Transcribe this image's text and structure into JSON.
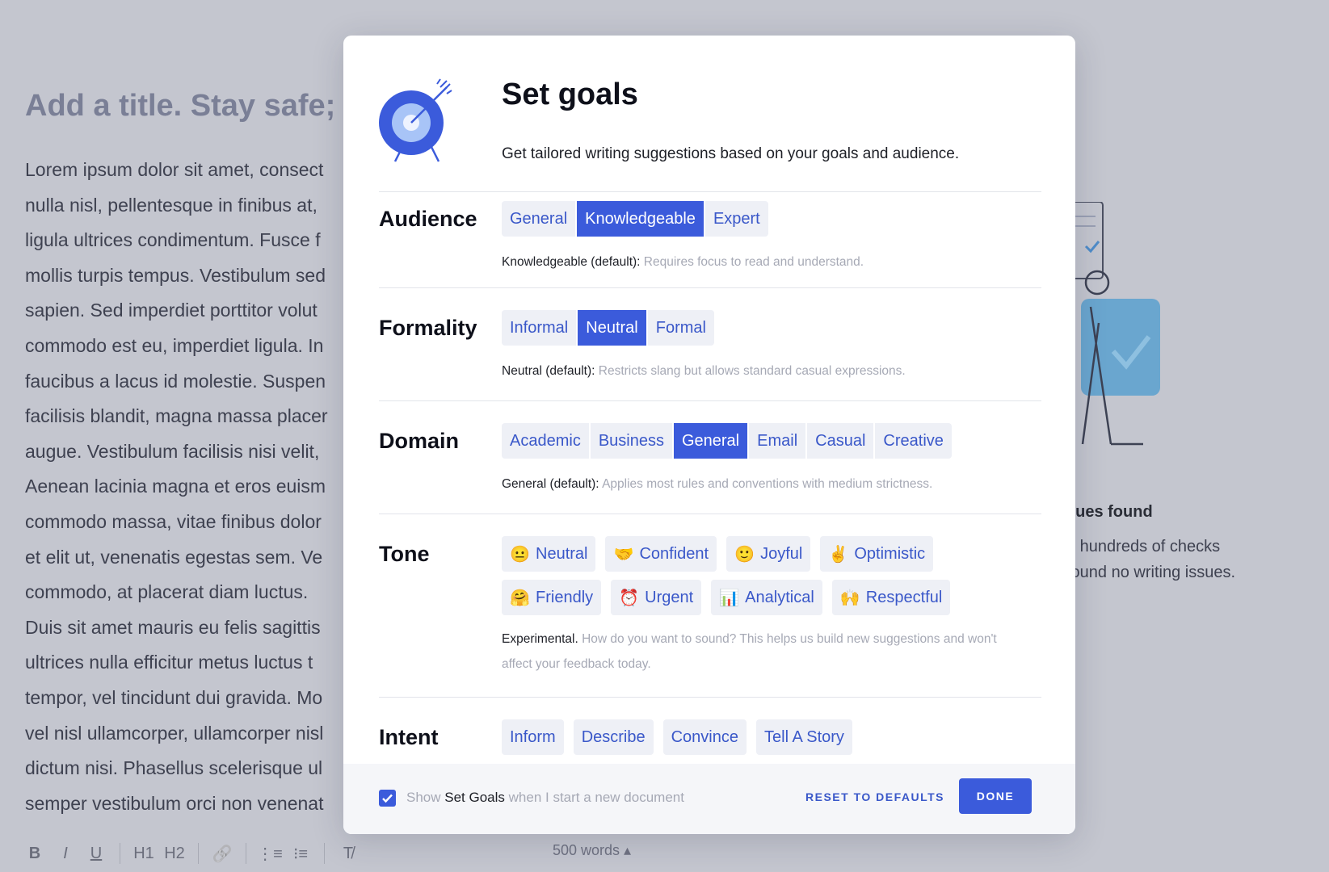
{
  "editor": {
    "title": "Add a title. Stay safe;",
    "body_lines": [
      "Lorem ipsum dolor sit amet, consect",
      "nulla nisl, pellentesque in finibus at,",
      "ligula ultrices condimentum. Fusce f",
      "mollis turpis tempus. Vestibulum sed",
      "sapien. Sed imperdiet porttitor volut",
      "commodo est eu, imperdiet ligula. In",
      "faucibus a lacus id molestie. Suspen",
      "facilisis blandit, magna massa placer",
      "augue. Vestibulum facilisis nisi velit,",
      "Aenean lacinia magna et eros euism",
      "commodo massa, vitae finibus dolor",
      "et elit ut, venenatis egestas sem. Ve",
      "commodo, at placerat diam luctus.",
      "Duis sit amet mauris eu felis sagittis",
      "ultrices nulla efficitur metus luctus t",
      "tempor, vel tincidunt dui gravida. Mo",
      "vel nisl ullamcorper, ullamcorper nisl",
      "dictum nisi. Phasellus scelerisque ul",
      "semper vestibulum orci non venenat"
    ],
    "toolbar": {
      "bold": "B",
      "italic": "I",
      "underline": "U",
      "h1": "H1",
      "h2": "H2",
      "link_icon": "🔗",
      "ordered_list": "⋮≡",
      "bullet_list": "⁝≡",
      "clear_format": "T̸"
    },
    "word_count": "500 words ▴",
    "sidebar": {
      "issues_title": "sues found",
      "issues_line1": "n hundreds of checks",
      "issues_line2": "found no writing issues."
    }
  },
  "modal": {
    "title": "Set goals",
    "subtitle": "Get tailored writing suggestions based on your goals and audience.",
    "audience": {
      "label": "Audience",
      "options": [
        "General",
        "Knowledgeable",
        "Expert"
      ],
      "selected": "Knowledgeable",
      "desc_strong": "Knowledgeable (default):",
      "desc": " Requires focus to read and understand."
    },
    "formality": {
      "label": "Formality",
      "options": [
        "Informal",
        "Neutral",
        "Formal"
      ],
      "selected": "Neutral",
      "desc_strong": "Neutral (default):",
      "desc": " Restricts slang but allows standard casual expressions."
    },
    "domain": {
      "label": "Domain",
      "options": [
        "Academic",
        "Business",
        "General",
        "Email",
        "Casual",
        "Creative"
      ],
      "selected": "General",
      "desc_strong": "General (default):",
      "desc": " Applies most rules and conventions with medium strictness."
    },
    "tone": {
      "label": "Tone",
      "row1": [
        {
          "emoji": "😐",
          "label": "Neutral"
        },
        {
          "emoji": "🤝",
          "label": "Confident"
        },
        {
          "emoji": "🙂",
          "label": "Joyful"
        },
        {
          "emoji": "✌",
          "label": "Optimistic"
        }
      ],
      "row2": [
        {
          "emoji": "🤗",
          "label": "Friendly"
        },
        {
          "emoji": "⏰",
          "label": "Urgent"
        },
        {
          "emoji": "📊",
          "label": "Analytical"
        },
        {
          "emoji": "🙌",
          "label": "Respectful"
        }
      ],
      "desc_strong": "Experimental.",
      "desc": " How do you want to sound? This helps us build new suggestions and won't affect your feedback today."
    },
    "intent": {
      "label": "Intent",
      "options": [
        "Inform",
        "Describe",
        "Convince",
        "Tell A Story"
      ]
    },
    "footer": {
      "show_prefix": "Show ",
      "show_strong": "Set Goals",
      "show_suffix": " when I start a new document",
      "checkbox_checked": true,
      "reset_label": "RESET TO DEFAULTS",
      "done_label": "DONE"
    }
  },
  "colors": {
    "accent": "#3b5bdb",
    "chip_bg": "#eef0f6",
    "overlay": "#c4c6cf"
  }
}
